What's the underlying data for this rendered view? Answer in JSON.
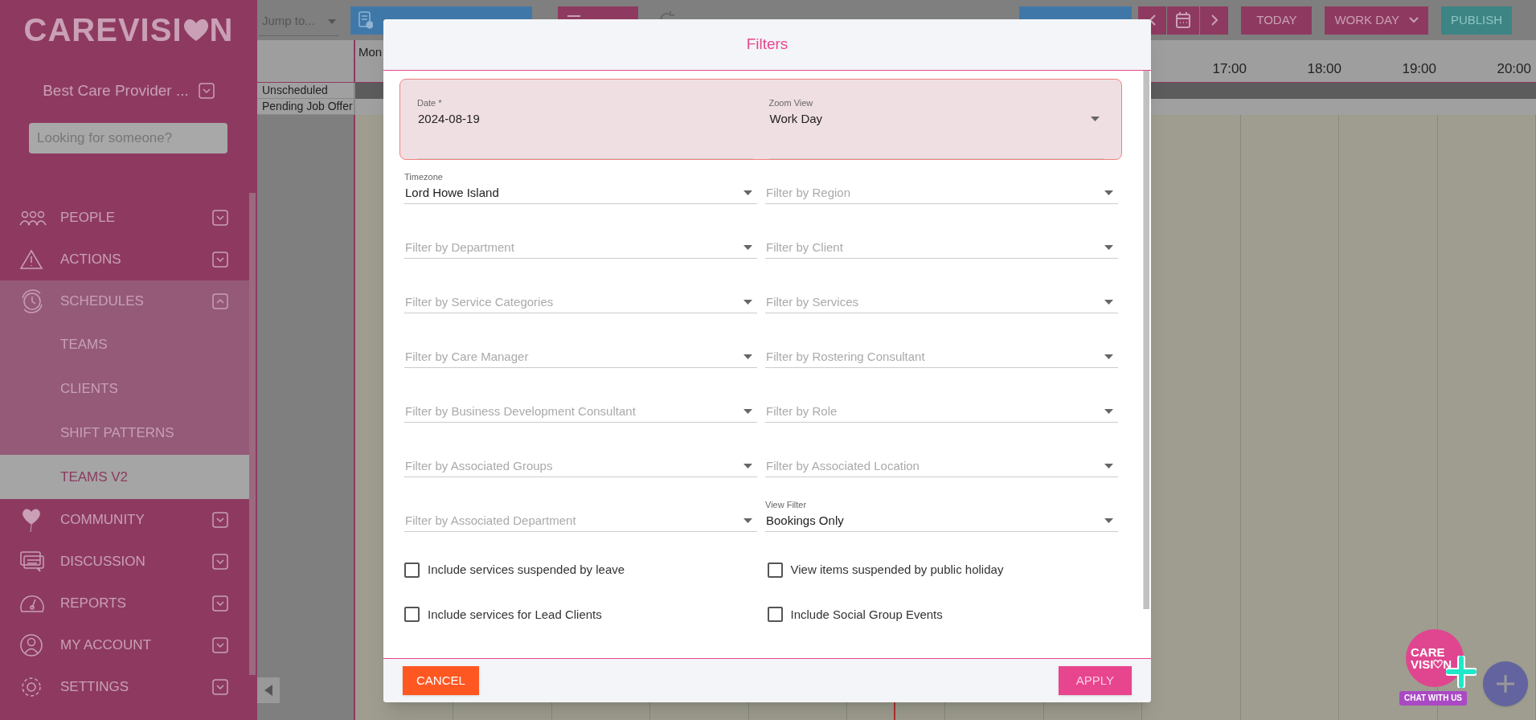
{
  "sidebar": {
    "logo_parts": [
      "CAREVISI",
      "N"
    ],
    "provider": "Best Care Provider ...",
    "search_placeholder": "Looking for someone?",
    "items": [
      {
        "label": "PEOPLE",
        "expanded": false
      },
      {
        "label": "ACTIONS",
        "expanded": false
      },
      {
        "label": "SCHEDULES",
        "expanded": true,
        "children": [
          {
            "label": "TEAMS",
            "selected": false
          },
          {
            "label": "CLIENTS",
            "selected": false
          },
          {
            "label": "SHIFT PATTERNS",
            "selected": false
          },
          {
            "label": "TEAMS V2",
            "selected": true
          }
        ]
      },
      {
        "label": "COMMUNITY",
        "expanded": false
      },
      {
        "label": "DISCUSSION",
        "expanded": false
      },
      {
        "label": "REPORTS",
        "expanded": false
      },
      {
        "label": "MY ACCOUNT",
        "expanded": false
      },
      {
        "label": "SETTINGS",
        "expanded": false
      }
    ]
  },
  "toolbar": {
    "jump_placeholder": "Jump to...",
    "today_button": "TODAY",
    "zoom_button": "WORK DAY",
    "publish_button": "PUBLISH"
  },
  "calendar": {
    "day": "Mon",
    "hours": [
      "17:00",
      "18:00",
      "19:00",
      "20:00"
    ],
    "rows": [
      "Unscheduled",
      "Pending Job Offer"
    ]
  },
  "modal": {
    "title": "Filters",
    "top_fields": [
      {
        "kind": "text",
        "label": "Date *",
        "value": "2024-08-19"
      },
      {
        "kind": "select",
        "label": "Zoom View",
        "value": "Work Day"
      }
    ],
    "field_rows": [
      [
        {
          "kind": "select",
          "label": "Timezone",
          "value": "Lord Howe Island"
        },
        {
          "kind": "select",
          "placeholder": "Filter by Region"
        }
      ],
      [
        {
          "kind": "select",
          "placeholder": "Filter by Department"
        },
        {
          "kind": "select",
          "placeholder": "Filter by Client"
        }
      ],
      [
        {
          "kind": "select",
          "placeholder": "Filter by Service Categories"
        },
        {
          "kind": "select",
          "placeholder": "Filter by Services"
        }
      ],
      [
        {
          "kind": "select",
          "placeholder": "Filter by Care Manager"
        },
        {
          "kind": "select",
          "placeholder": "Filter by Rostering Consultant"
        }
      ],
      [
        {
          "kind": "select",
          "placeholder": "Filter by Business Development Consultant"
        },
        {
          "kind": "select",
          "placeholder": "Filter by Role"
        }
      ],
      [
        {
          "kind": "select",
          "placeholder": "Filter by Associated Groups"
        },
        {
          "kind": "select",
          "placeholder": "Filter by Associated Location"
        }
      ],
      [
        {
          "kind": "select",
          "placeholder": "Filter by Associated Department"
        },
        {
          "kind": "select",
          "label": "View Filter",
          "value": "Bookings Only"
        }
      ]
    ],
    "checkboxes": [
      {
        "label": "Include services suspended by leave",
        "checked": false
      },
      {
        "label": "View items suspended by public holiday",
        "checked": false
      },
      {
        "label": "Include services for Lead Clients",
        "checked": false
      },
      {
        "label": "Include Social Group Events",
        "checked": false
      }
    ],
    "cancel_button": "CANCEL",
    "apply_button": "APPLY"
  },
  "chat_widget": {
    "logo_top": "CARE",
    "logo_bottom_parts": [
      "VISI",
      "N"
    ],
    "label": "CHAT WITH US"
  }
}
